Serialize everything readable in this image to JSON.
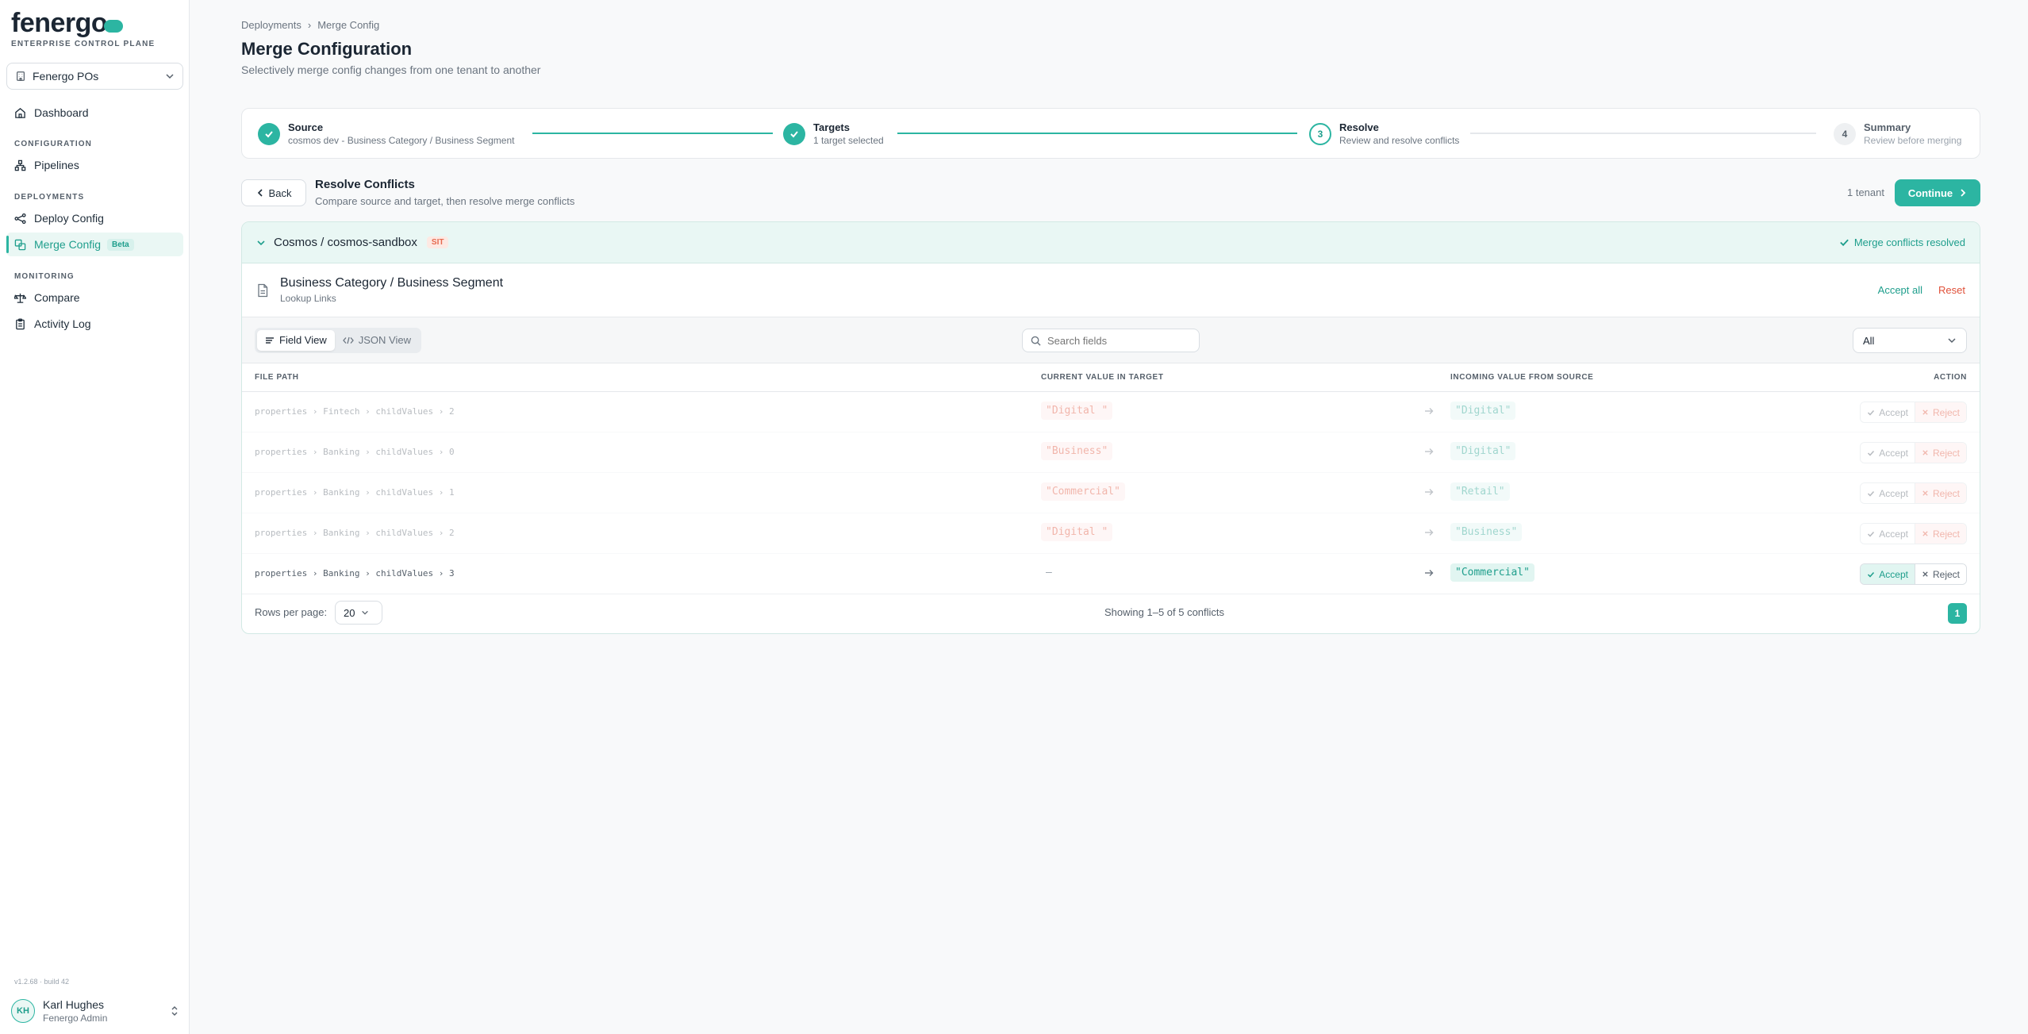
{
  "brand": {
    "logo": "fenergo",
    "subtitle": "ENTERPRISE CONTROL PLANE"
  },
  "org": {
    "name": "Fenergo POs"
  },
  "nav": {
    "dashboard": "Dashboard",
    "section_configuration": "CONFIGURATION",
    "pipelines": "Pipelines",
    "section_deployments": "DEPLOYMENTS",
    "deploy_config": "Deploy Config",
    "merge_config": "Merge Config",
    "beta": "Beta",
    "section_monitoring": "MONITORING",
    "compare": "Compare",
    "activity_log": "Activity Log"
  },
  "version": "v1.2.68 · build 42",
  "user": {
    "initials": "KH",
    "name": "Karl Hughes",
    "role": "Fenergo Admin"
  },
  "breadcrumb": {
    "parent": "Deployments",
    "separator": "›",
    "current": "Merge Config"
  },
  "page": {
    "title": "Merge Configuration",
    "subtitle": "Selectively merge config changes from one tenant to another"
  },
  "steps": [
    {
      "title": "Source",
      "sub": "cosmos dev - Business Category / Business Segment",
      "state": "done"
    },
    {
      "title": "Targets",
      "sub": "1 target selected",
      "state": "done"
    },
    {
      "number": "3",
      "title": "Resolve",
      "sub": "Review and resolve conflicts",
      "state": "current"
    },
    {
      "number": "4",
      "title": "Summary",
      "sub": "Review before merging",
      "state": "todo"
    }
  ],
  "resolve": {
    "back": "Back",
    "title": "Resolve Conflicts",
    "subtitle": "Compare source and target, then resolve merge conflicts",
    "tenant_count": "1 tenant",
    "continue": "Continue"
  },
  "tenant": {
    "name": "Cosmos / cosmos-sandbox",
    "env": "SIT",
    "status": "Merge conflicts resolved"
  },
  "file": {
    "title": "Business Category / Business Segment",
    "sub": "Lookup Links",
    "accept_all": "Accept all",
    "reset": "Reset"
  },
  "toolbar": {
    "field_view": "Field View",
    "json_view": "JSON View",
    "search_placeholder": "Search fields",
    "filter": "All"
  },
  "table": {
    "headers": {
      "path": "FILE PATH",
      "current": "CURRENT VALUE IN TARGET",
      "incoming": "INCOMING VALUE FROM SOURCE",
      "action": "ACTION"
    },
    "accept": "Accept",
    "reject": "Reject",
    "rows": [
      {
        "path": "properties › Fintech › childValues › 2",
        "current": "\"Digital \"",
        "incoming": "\"Digital\"",
        "decision": "reject"
      },
      {
        "path": "properties › Banking › childValues › 0",
        "current": "\"Business\"",
        "incoming": "\"Digital\"",
        "decision": "reject"
      },
      {
        "path": "properties › Banking › childValues › 1",
        "current": "\"Commercial\"",
        "incoming": "\"Retail\"",
        "decision": "reject"
      },
      {
        "path": "properties › Banking › childValues › 2",
        "current": "\"Digital \"",
        "incoming": "\"Business\"",
        "decision": "reject"
      },
      {
        "path": "properties › Banking › childValues › 3",
        "current": "—",
        "incoming": "\"Commercial\"",
        "decision": "accept"
      }
    ]
  },
  "footer": {
    "rows_label": "Rows per page:",
    "rows_value": "20",
    "showing": "Showing 1–5 of 5 conflicts",
    "page": "1"
  },
  "colors": {
    "accent": "#2cb5a2",
    "danger": "#e0513a"
  }
}
